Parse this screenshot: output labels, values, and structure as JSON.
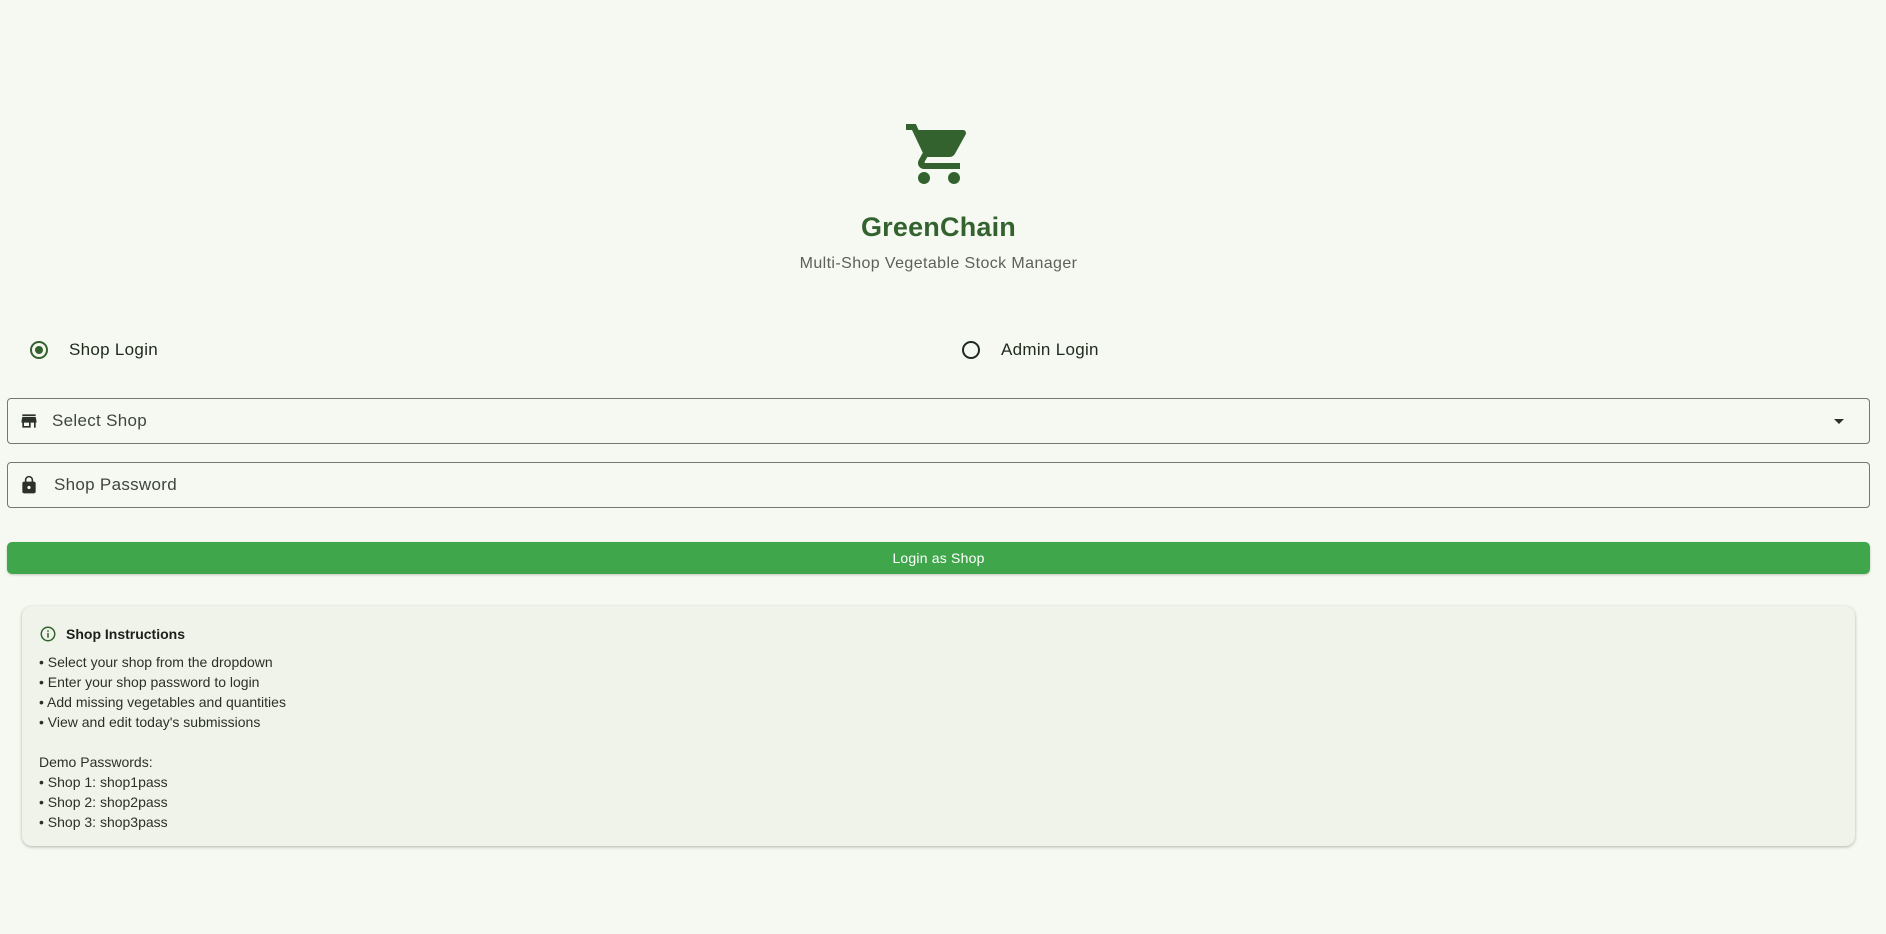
{
  "app": {
    "title": "GreenChain",
    "subtitle": "Multi-Shop Vegetable Stock Manager",
    "logo_icon": "shopping-cart-icon",
    "brand_color": "#33622f",
    "accent_color": "#40a64b"
  },
  "login_mode": {
    "options": [
      {
        "label": "Shop Login",
        "selected": true
      },
      {
        "label": "Admin Login",
        "selected": false
      }
    ]
  },
  "form": {
    "shop_select": {
      "placeholder": "Select Shop",
      "icon": "store-icon"
    },
    "password": {
      "placeholder": "Shop Password",
      "icon": "lock-icon"
    },
    "submit_label": "Login as Shop"
  },
  "instructions": {
    "title": "Shop Instructions",
    "icon": "info-icon",
    "lines": [
      "• Select your shop from the dropdown",
      "• Enter your shop password to login",
      "• Add missing vegetables and quantities",
      "• View and edit today's submissions",
      "",
      "Demo Passwords:",
      "• Shop 1: shop1pass",
      "• Shop 2: shop2pass",
      "• Shop 3: shop3pass"
    ]
  }
}
